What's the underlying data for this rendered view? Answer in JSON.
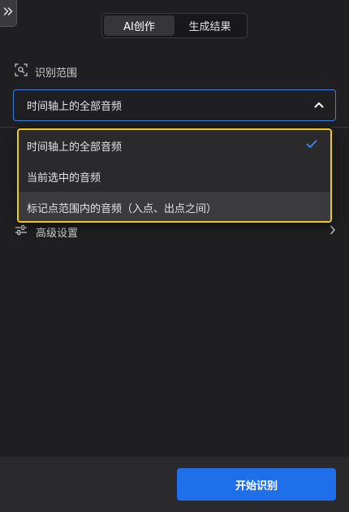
{
  "tabs": [
    {
      "label": "AI创作",
      "active": true
    },
    {
      "label": "生成结果",
      "active": false
    }
  ],
  "range_section": {
    "title": "识别范围",
    "icon": "scan-range-icon"
  },
  "range_select": {
    "value": "时间轴上的全部音频",
    "icon": "chevron-up-icon"
  },
  "dropdown": {
    "options": [
      {
        "label": "时间轴上的全部音频",
        "selected": true
      },
      {
        "label": "当前选中的音频",
        "selected": false
      },
      {
        "label": "标记点范围内的音频（入点、出点之间）",
        "selected": false
      }
    ]
  },
  "advanced": {
    "label": "高级设置",
    "icon": "sliders-icon"
  },
  "footer": {
    "start_label": "开始识别"
  },
  "colors": {
    "accent": "#1f6feb",
    "focus_border": "#3d7fe0",
    "highlight_outline": "#f0c81e",
    "check": "#3d8bfd"
  }
}
